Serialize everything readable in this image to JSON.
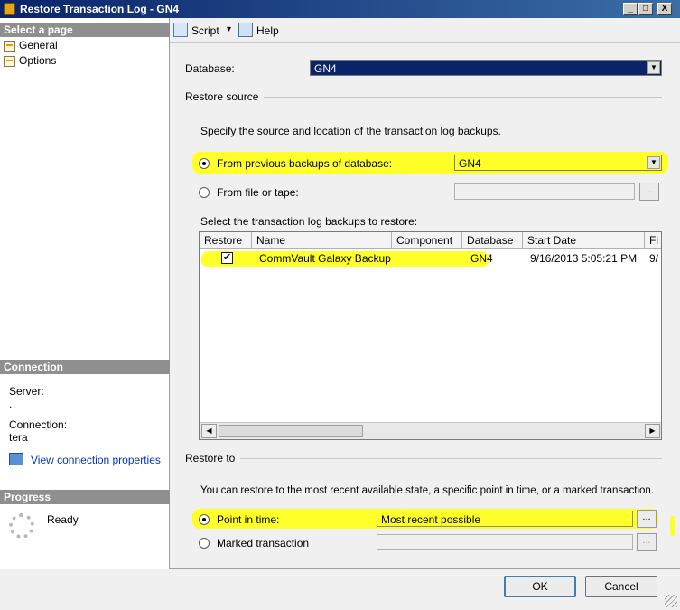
{
  "window": {
    "title": "Restore Transaction Log  -  GN4",
    "minimize": "_",
    "maximize": "□",
    "close": "X"
  },
  "left": {
    "select_page_header": "Select a page",
    "pages": [
      {
        "label": "General"
      },
      {
        "label": "Options"
      }
    ],
    "connection_header": "Connection",
    "server_label": "Server:",
    "server_value": ".",
    "connection_label": "Connection:",
    "connection_value": "tera",
    "view_connection": "View connection properties",
    "progress_header": "Progress",
    "progress_status": "Ready"
  },
  "toolbar": {
    "script_label": "Script",
    "script_arrow": "▾",
    "help_label": "Help"
  },
  "form": {
    "database_label": "Database:",
    "database_value": "GN4",
    "restore_source_label": "Restore source",
    "source_desc": "Specify the source and location of the transaction log backups.",
    "from_previous_label": "From previous backups of database:",
    "from_previous_value": "GN4",
    "from_file_label": "From file or tape:",
    "from_file_value": "",
    "browse": "...",
    "select_backups_label": "Select the transaction log backups to restore:",
    "restore_to_label": "Restore to",
    "restore_to_desc": "You can restore to the most recent available state, a specific point in time, or a marked transaction.",
    "point_in_time_label": "Point in time:",
    "point_in_time_value": "Most recent possible",
    "marked_transaction_label": "Marked transaction",
    "marked_transaction_value": ""
  },
  "grid": {
    "columns": [
      "Restore",
      "Name",
      "Component",
      "Database",
      "Start Date",
      "Fi"
    ],
    "rows": [
      {
        "restore": "✔",
        "name": "CommVault Galaxy Backup",
        "component": "",
        "database": "GN4",
        "start_date": "9/16/2013 5:05:21 PM",
        "finish": "9/"
      }
    ]
  },
  "buttons": {
    "ok": "OK",
    "cancel": "Cancel"
  },
  "colors": {
    "highlight": "#ffff2a",
    "selection": "#0a246a"
  }
}
